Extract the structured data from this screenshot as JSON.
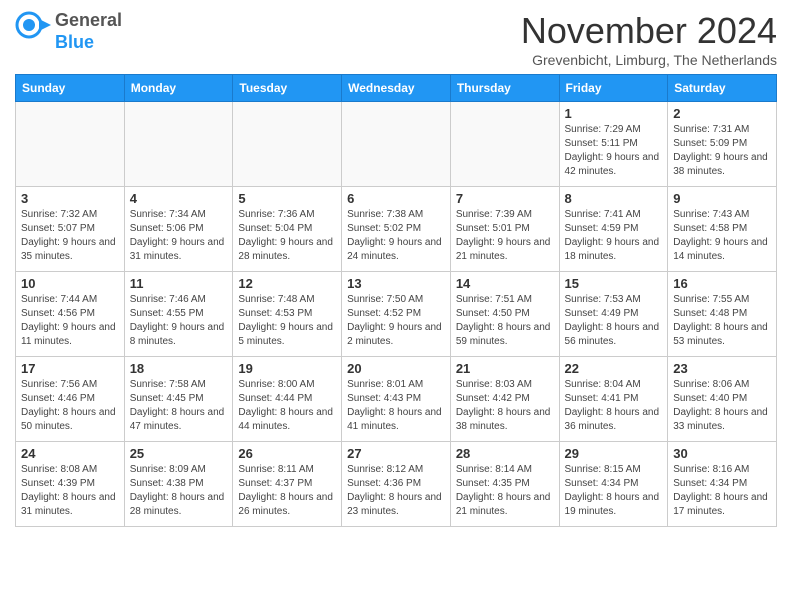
{
  "header": {
    "logo": {
      "line1": "General",
      "line2": "Blue"
    },
    "month_title": "November 2024",
    "subtitle": "Grevenbicht, Limburg, The Netherlands"
  },
  "days_of_week": [
    "Sunday",
    "Monday",
    "Tuesday",
    "Wednesday",
    "Thursday",
    "Friday",
    "Saturday"
  ],
  "weeks": [
    [
      {
        "day": "",
        "info": ""
      },
      {
        "day": "",
        "info": ""
      },
      {
        "day": "",
        "info": ""
      },
      {
        "day": "",
        "info": ""
      },
      {
        "day": "",
        "info": ""
      },
      {
        "day": "1",
        "info": "Sunrise: 7:29 AM\nSunset: 5:11 PM\nDaylight: 9 hours and 42 minutes."
      },
      {
        "day": "2",
        "info": "Sunrise: 7:31 AM\nSunset: 5:09 PM\nDaylight: 9 hours and 38 minutes."
      }
    ],
    [
      {
        "day": "3",
        "info": "Sunrise: 7:32 AM\nSunset: 5:07 PM\nDaylight: 9 hours and 35 minutes."
      },
      {
        "day": "4",
        "info": "Sunrise: 7:34 AM\nSunset: 5:06 PM\nDaylight: 9 hours and 31 minutes."
      },
      {
        "day": "5",
        "info": "Sunrise: 7:36 AM\nSunset: 5:04 PM\nDaylight: 9 hours and 28 minutes."
      },
      {
        "day": "6",
        "info": "Sunrise: 7:38 AM\nSunset: 5:02 PM\nDaylight: 9 hours and 24 minutes."
      },
      {
        "day": "7",
        "info": "Sunrise: 7:39 AM\nSunset: 5:01 PM\nDaylight: 9 hours and 21 minutes."
      },
      {
        "day": "8",
        "info": "Sunrise: 7:41 AM\nSunset: 4:59 PM\nDaylight: 9 hours and 18 minutes."
      },
      {
        "day": "9",
        "info": "Sunrise: 7:43 AM\nSunset: 4:58 PM\nDaylight: 9 hours and 14 minutes."
      }
    ],
    [
      {
        "day": "10",
        "info": "Sunrise: 7:44 AM\nSunset: 4:56 PM\nDaylight: 9 hours and 11 minutes."
      },
      {
        "day": "11",
        "info": "Sunrise: 7:46 AM\nSunset: 4:55 PM\nDaylight: 9 hours and 8 minutes."
      },
      {
        "day": "12",
        "info": "Sunrise: 7:48 AM\nSunset: 4:53 PM\nDaylight: 9 hours and 5 minutes."
      },
      {
        "day": "13",
        "info": "Sunrise: 7:50 AM\nSunset: 4:52 PM\nDaylight: 9 hours and 2 minutes."
      },
      {
        "day": "14",
        "info": "Sunrise: 7:51 AM\nSunset: 4:50 PM\nDaylight: 8 hours and 59 minutes."
      },
      {
        "day": "15",
        "info": "Sunrise: 7:53 AM\nSunset: 4:49 PM\nDaylight: 8 hours and 56 minutes."
      },
      {
        "day": "16",
        "info": "Sunrise: 7:55 AM\nSunset: 4:48 PM\nDaylight: 8 hours and 53 minutes."
      }
    ],
    [
      {
        "day": "17",
        "info": "Sunrise: 7:56 AM\nSunset: 4:46 PM\nDaylight: 8 hours and 50 minutes."
      },
      {
        "day": "18",
        "info": "Sunrise: 7:58 AM\nSunset: 4:45 PM\nDaylight: 8 hours and 47 minutes."
      },
      {
        "day": "19",
        "info": "Sunrise: 8:00 AM\nSunset: 4:44 PM\nDaylight: 8 hours and 44 minutes."
      },
      {
        "day": "20",
        "info": "Sunrise: 8:01 AM\nSunset: 4:43 PM\nDaylight: 8 hours and 41 minutes."
      },
      {
        "day": "21",
        "info": "Sunrise: 8:03 AM\nSunset: 4:42 PM\nDaylight: 8 hours and 38 minutes."
      },
      {
        "day": "22",
        "info": "Sunrise: 8:04 AM\nSunset: 4:41 PM\nDaylight: 8 hours and 36 minutes."
      },
      {
        "day": "23",
        "info": "Sunrise: 8:06 AM\nSunset: 4:40 PM\nDaylight: 8 hours and 33 minutes."
      }
    ],
    [
      {
        "day": "24",
        "info": "Sunrise: 8:08 AM\nSunset: 4:39 PM\nDaylight: 8 hours and 31 minutes."
      },
      {
        "day": "25",
        "info": "Sunrise: 8:09 AM\nSunset: 4:38 PM\nDaylight: 8 hours and 28 minutes."
      },
      {
        "day": "26",
        "info": "Sunrise: 8:11 AM\nSunset: 4:37 PM\nDaylight: 8 hours and 26 minutes."
      },
      {
        "day": "27",
        "info": "Sunrise: 8:12 AM\nSunset: 4:36 PM\nDaylight: 8 hours and 23 minutes."
      },
      {
        "day": "28",
        "info": "Sunrise: 8:14 AM\nSunset: 4:35 PM\nDaylight: 8 hours and 21 minutes."
      },
      {
        "day": "29",
        "info": "Sunrise: 8:15 AM\nSunset: 4:34 PM\nDaylight: 8 hours and 19 minutes."
      },
      {
        "day": "30",
        "info": "Sunrise: 8:16 AM\nSunset: 4:34 PM\nDaylight: 8 hours and 17 minutes."
      }
    ]
  ]
}
